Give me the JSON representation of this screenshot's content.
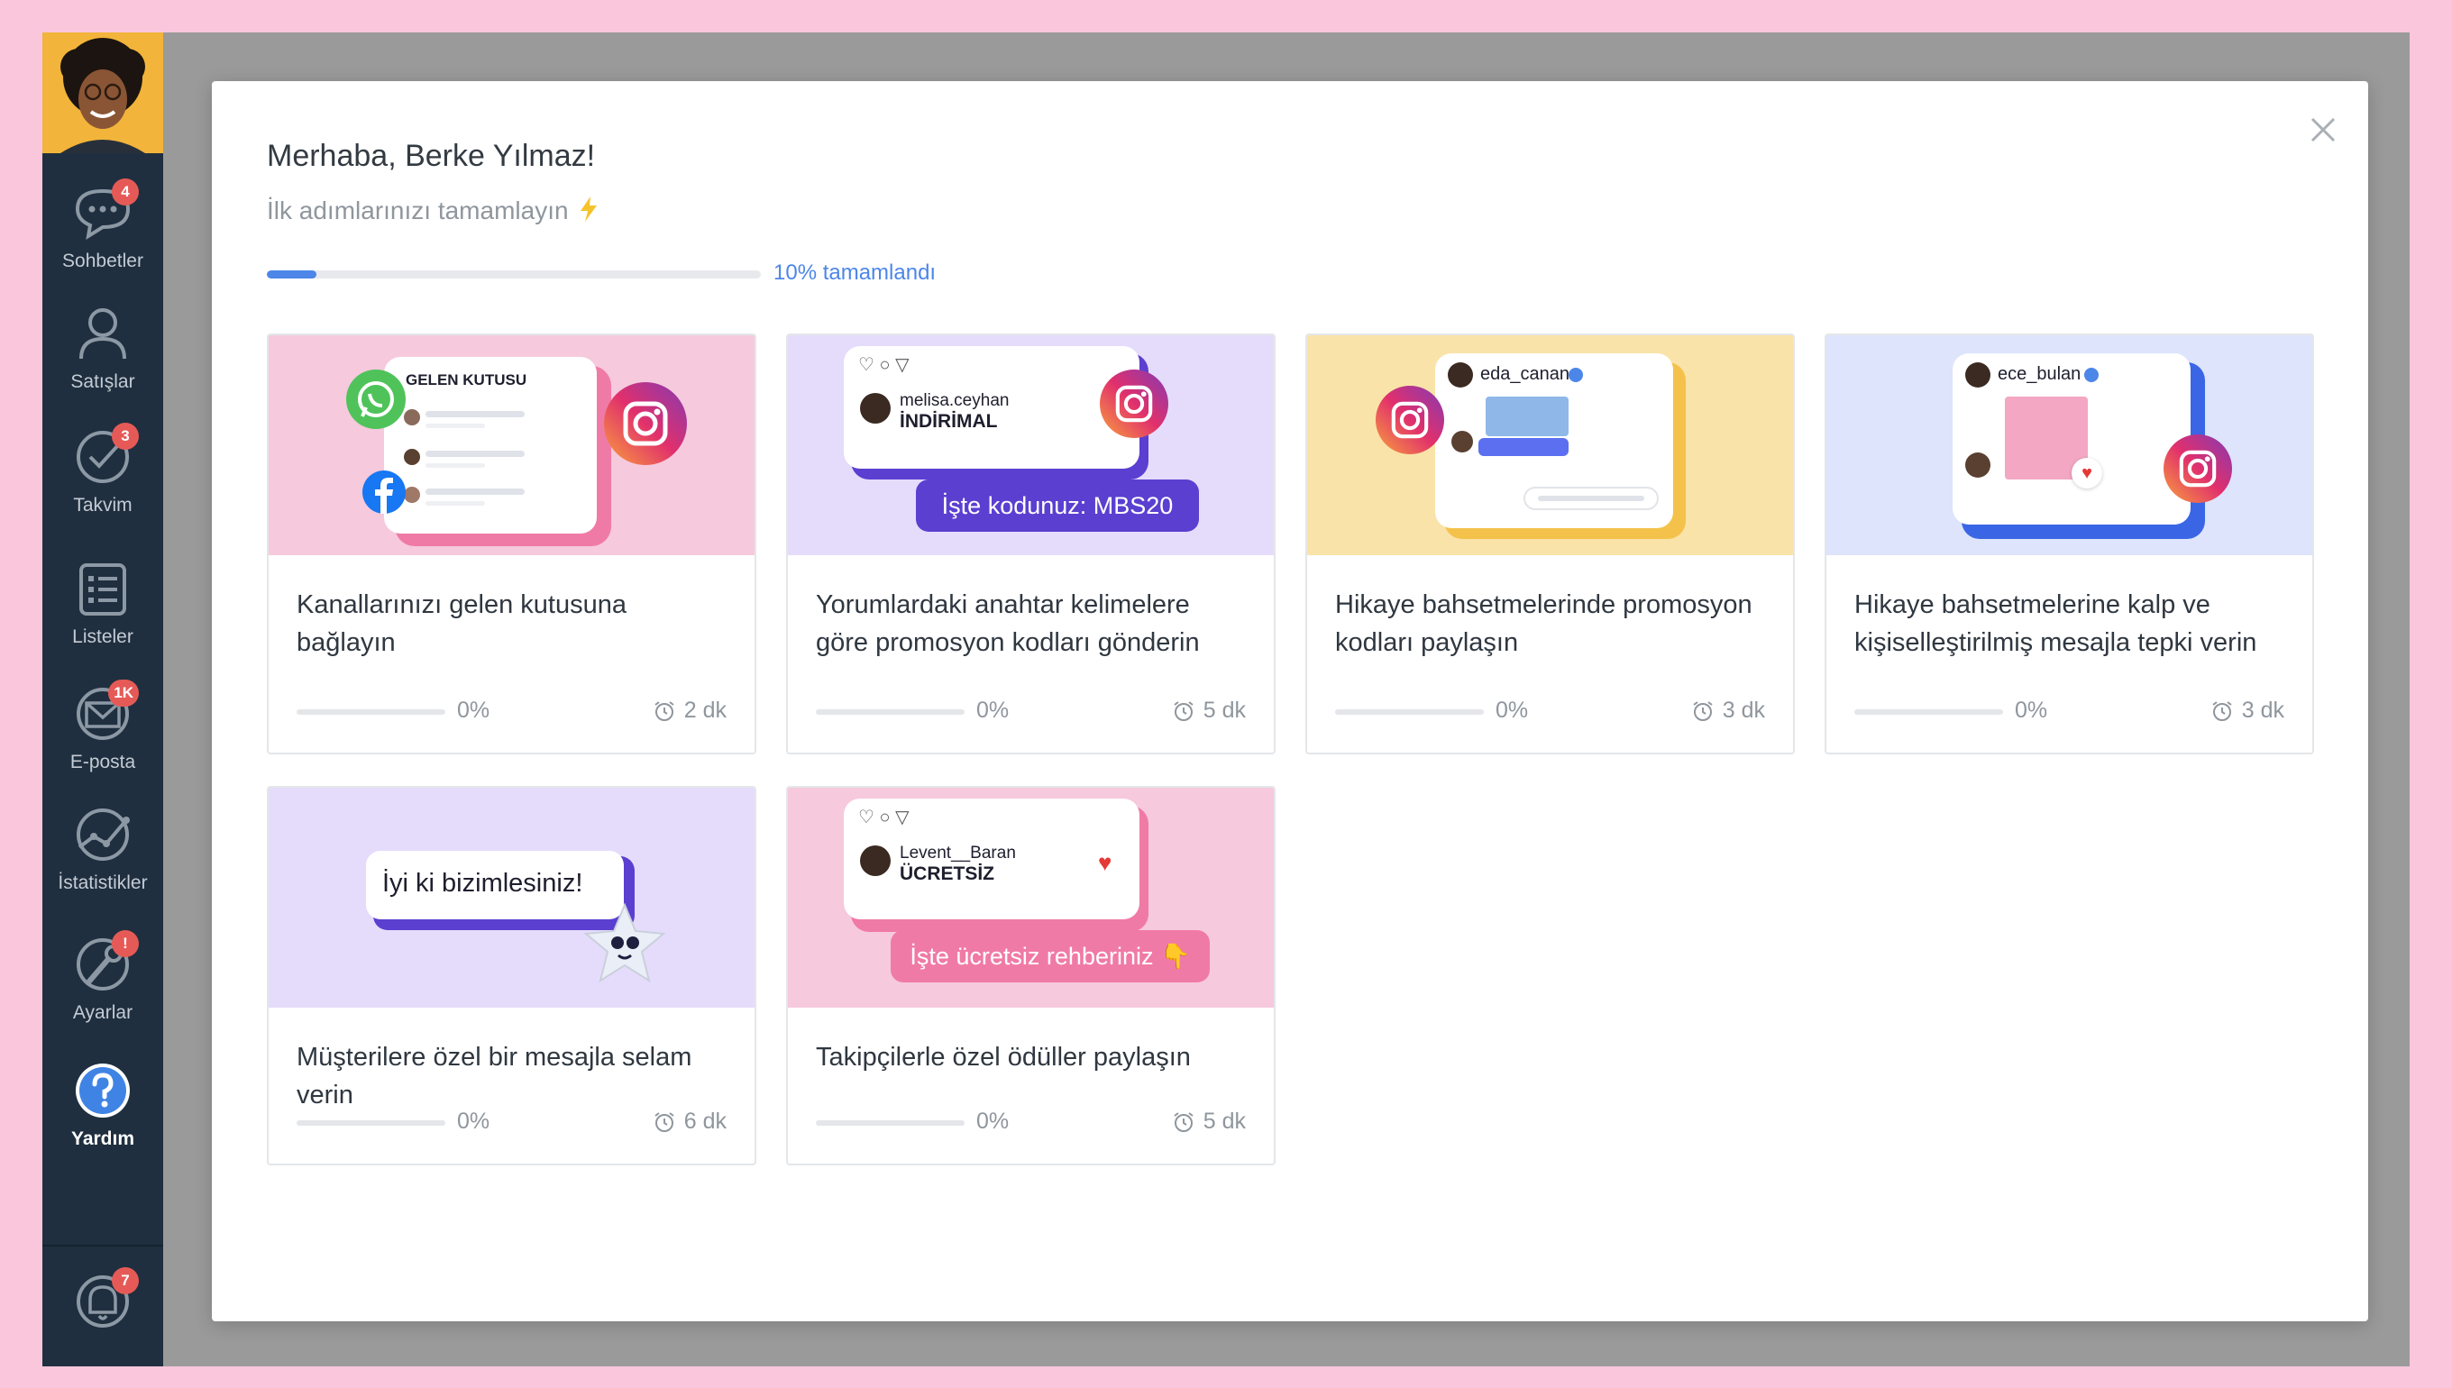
{
  "sidebar": {
    "items": [
      {
        "label": "Sohbetler",
        "badge": "4"
      },
      {
        "label": "Satışlar",
        "badge": ""
      },
      {
        "label": "Takvim",
        "badge": "3"
      },
      {
        "label": "Listeler",
        "badge": ""
      },
      {
        "label": "E-posta",
        "badge": "1K"
      },
      {
        "label": "İstatistikler",
        "badge": ""
      },
      {
        "label": "Ayarlar",
        "badge": "!"
      },
      {
        "label": "Yardım",
        "badge": "",
        "active": true
      }
    ],
    "notifications_badge": "7"
  },
  "modal": {
    "greeting": "Merhaba, Berke Yılmaz!",
    "subtitle": "İlk adımlarınızı tamamlayın",
    "progress": {
      "percent": 10,
      "label": "10% tamamlandı"
    }
  },
  "cards": [
    {
      "title": "Kanallarınızı gelen kutusuna bağlayın",
      "percent_label": "0%",
      "percent": 0,
      "duration": "2 dk",
      "art": {
        "inbox_title": "GELEN KUTUSU"
      }
    },
    {
      "title": "Yorumlardaki anahtar kelimelere göre promosyon kodları gönderin",
      "percent_label": "0%",
      "percent": 0,
      "duration": "5 dk",
      "art": {
        "username": "melisa.ceyhan",
        "comment": "İNDİRİMAL",
        "reply": "İşte kodunuz: MBS20"
      }
    },
    {
      "title": "Hikaye bahsetmelerinde promosyon kodları paylaşın",
      "percent_label": "0%",
      "percent": 0,
      "duration": "3 dk",
      "art": {
        "username": "eda_canan"
      }
    },
    {
      "title": "Hikaye bahsetmelerine kalp ve kişiselleştirilmiş mesajla tepki verin",
      "percent_label": "0%",
      "percent": 0,
      "duration": "3 dk",
      "art": {
        "username": "ece_bulan"
      }
    },
    {
      "title": "Müşterilere özel bir mesajla selam verin",
      "percent_label": "0%",
      "percent": 0,
      "duration": "6 dk",
      "art": {
        "message": "İyi ki bizimlesiniz!"
      }
    },
    {
      "title": "Takipçilerle özel ödüller paylaşın",
      "percent_label": "0%",
      "percent": 0,
      "duration": "5 dk",
      "art": {
        "username": "Levent__Baran",
        "comment": "ÜCRETSİZ",
        "reply": "İşte ücretsiz rehberiniz 👇"
      }
    }
  ],
  "colors": {
    "accent": "#4c86e8",
    "sidebar_bg": "#1f2f3f",
    "page_bg": "#f9c6dc",
    "badge": "#e55a57",
    "card_pink": "#f6c9dd",
    "card_lavender": "#e5dcfb",
    "card_yellow": "#f9e3a8",
    "card_blue": "#dde4fb",
    "purple": "#5b3fd0"
  },
  "icons": [
    "chat-bubble-icon",
    "users-icon",
    "checkmark-icon",
    "list-icon",
    "envelope-icon",
    "stats-icon",
    "wrench-icon",
    "help-icon",
    "bell-icon",
    "close-icon",
    "lightning-icon",
    "alarm-clock-icon",
    "instagram-icon",
    "whatsapp-icon",
    "facebook-icon"
  ]
}
